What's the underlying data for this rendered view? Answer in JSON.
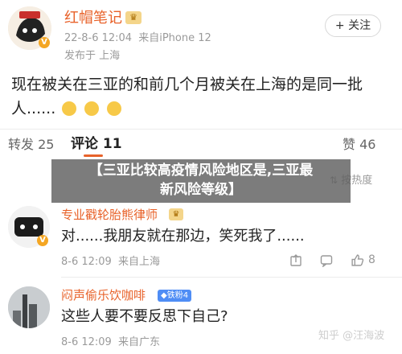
{
  "post": {
    "author": "红帽笔记",
    "timestamp": "22-8-6 12:04",
    "source": "来自iPhone 12",
    "location": "发布于 上海",
    "follow_label": "+ 关注",
    "content": "现在被关在三亚的和前几个月被关在上海的是同一批人......",
    "emoji_count": 3
  },
  "tabs": {
    "reposts_label": "转发",
    "reposts_count": "25",
    "comments_label": "评论",
    "comments_count": "11",
    "likes_label": "赞",
    "likes_count": "46",
    "sort_label": "按热度"
  },
  "overlay": {
    "line1": "【三亚比较高疫情风险地区是,三亚最",
    "line2": "新风险等级】"
  },
  "comments": [
    {
      "author": "专业戳轮胎熊律师",
      "text": "对......我朋友就在那边，笑死我了......",
      "timestamp": "8-6 12:09",
      "source": "来自上海",
      "likes": "8"
    },
    {
      "author": "闷声偷乐饮咖啡",
      "badge": "铁粉4",
      "text": "这些人要不要反思下自己?",
      "timestamp": "8-6 12:09",
      "source": "来自广东"
    }
  ],
  "watermark": "知乎 @汪海波",
  "colors": {
    "name": "#e8622a",
    "muted": "#9a9a9a",
    "overlay": "#5f5f5f",
    "badge_blue": "#4f8df5",
    "vip_gold": "#f4a623"
  }
}
